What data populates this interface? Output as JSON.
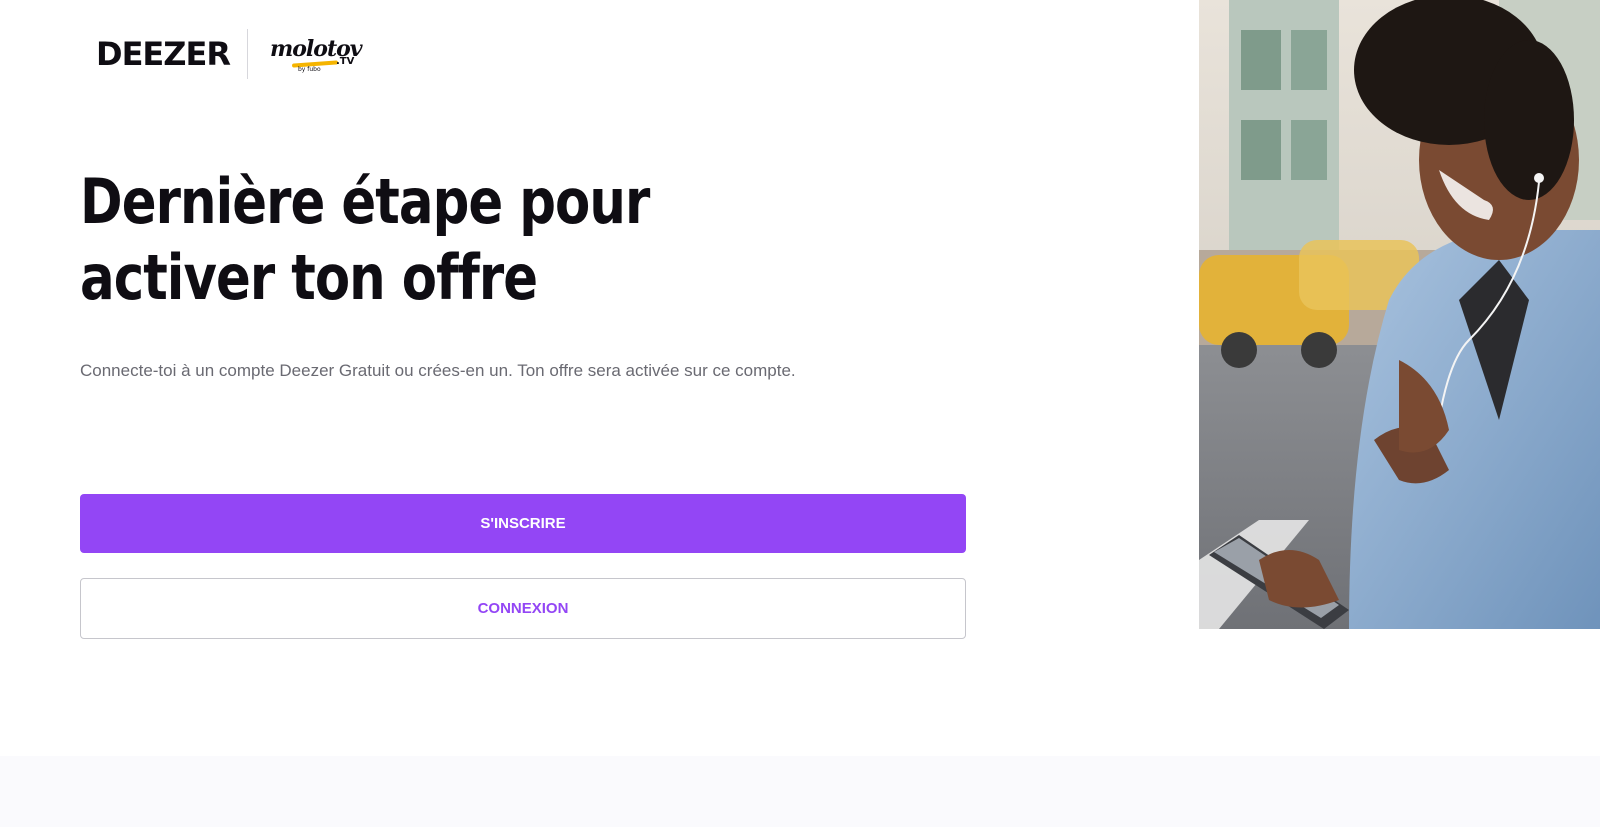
{
  "header": {
    "deezer_logo": "DEEZER",
    "partner_logo": "molotov.tv by fubo"
  },
  "main": {
    "headline": "Dernière étape pour activer ton offre",
    "subtitle": "Connecte-toi à un compte Deezer Gratuit ou crées-en un. Ton offre sera activée sur ce compte.",
    "signup_label": "S'INSCRIRE",
    "login_label": "CONNEXION"
  },
  "colors": {
    "accent": "#9346f5",
    "text_dark": "#0f0d13",
    "text_muted": "#6a6a72"
  }
}
